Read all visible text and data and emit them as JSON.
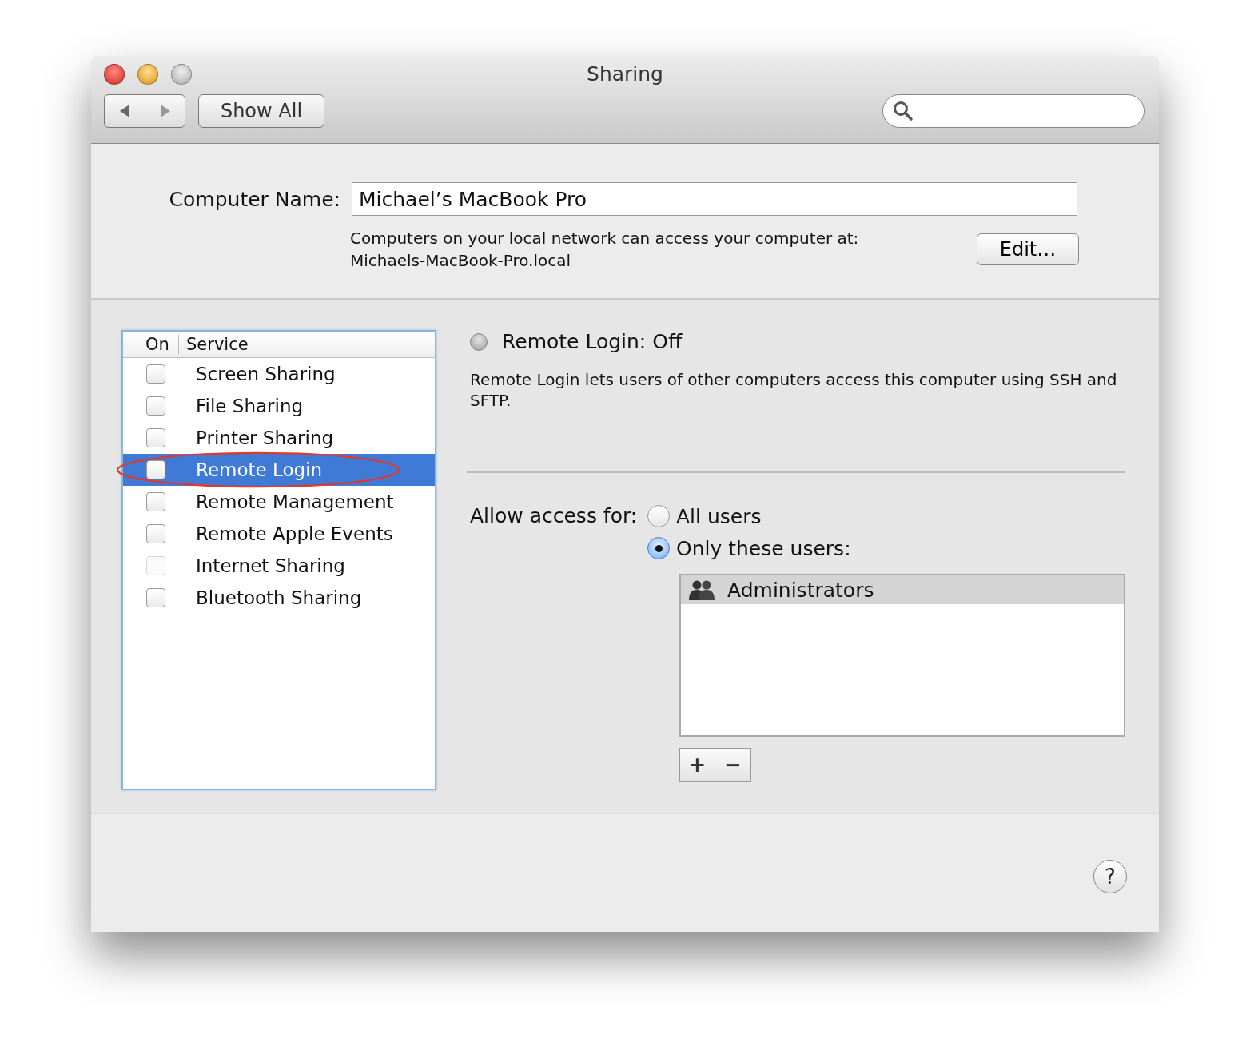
{
  "window": {
    "title": "Sharing"
  },
  "toolbar": {
    "show_all": "Show All"
  },
  "computer_name": {
    "label": "Computer Name:",
    "value": "Michael’s MacBook Pro",
    "note": "Computers on your local network can access your computer at:",
    "address": "Michaels-MacBook-Pro.local",
    "edit_button": "Edit…"
  },
  "services": {
    "columns": [
      "On",
      "Service"
    ],
    "items": [
      {
        "name": "Screen Sharing",
        "checked": false,
        "selected": false,
        "disabled": false,
        "circled": false
      },
      {
        "name": "File Sharing",
        "checked": false,
        "selected": false,
        "disabled": false,
        "circled": false
      },
      {
        "name": "Printer Sharing",
        "checked": false,
        "selected": false,
        "disabled": false,
        "circled": false
      },
      {
        "name": "Remote Login",
        "checked": false,
        "selected": true,
        "disabled": false,
        "circled": true
      },
      {
        "name": "Remote Management",
        "checked": false,
        "selected": false,
        "disabled": false,
        "circled": false
      },
      {
        "name": "Remote Apple Events",
        "checked": false,
        "selected": false,
        "disabled": false,
        "circled": false
      },
      {
        "name": "Internet Sharing",
        "checked": false,
        "selected": false,
        "disabled": true,
        "circled": false
      },
      {
        "name": "Bluetooth Sharing",
        "checked": false,
        "selected": false,
        "disabled": false,
        "circled": false
      }
    ]
  },
  "detail": {
    "status": "Remote Login: Off",
    "on": false,
    "description": "Remote Login lets users of other computers access this computer using SSH and SFTP.",
    "access_label": "Allow access for:",
    "access_options": [
      {
        "label": "All users",
        "selected": false
      },
      {
        "label": "Only these users:",
        "selected": true
      }
    ],
    "users": [
      {
        "name": "Administrators",
        "selected": true
      }
    ],
    "buttons": [
      "+",
      "−"
    ]
  },
  "help_button": "?"
}
